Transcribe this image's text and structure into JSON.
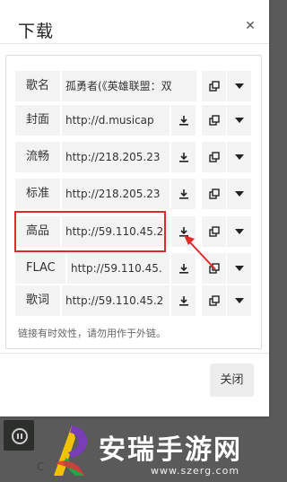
{
  "dialog": {
    "title": "下载",
    "close_icon": "close-icon",
    "rows": [
      {
        "label": "歌名",
        "value": "孤勇者(《英雄联盟：双",
        "has_download": false
      },
      {
        "label": "封面",
        "value": "http://d.musicap",
        "has_download": true
      },
      {
        "label": "流畅",
        "value": "http://218.205.23",
        "has_download": true
      },
      {
        "label": "标准",
        "value": "http://218.205.23",
        "has_download": true
      },
      {
        "label": "高品",
        "value": "http://59.110.45.2",
        "has_download": true
      },
      {
        "label": "FLAC",
        "value": "http://59.110.45.",
        "has_download": true
      },
      {
        "label": "歌词",
        "value": "http://59.110.45.2",
        "has_download": true
      }
    ],
    "note": "链接有时效性，请勿用作于外链。",
    "close_button": "关闭"
  },
  "player": {
    "text": "C"
  },
  "watermark": {
    "name": "安瑞手游网",
    "url": "www.szerg.com"
  },
  "colors": {
    "highlight": "#e02a2a",
    "cell_bg": "#f3f3f3"
  }
}
